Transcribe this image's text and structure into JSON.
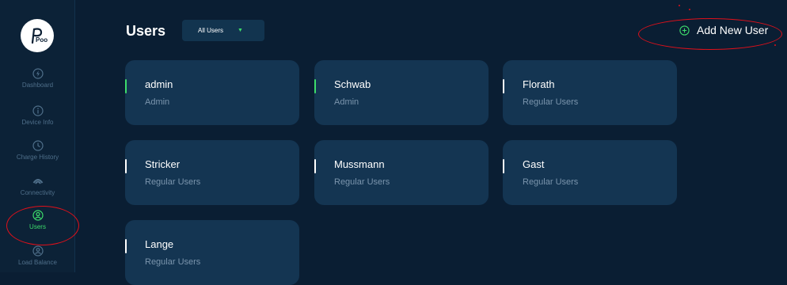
{
  "sidebar": {
    "logo_text": "Poo",
    "items": [
      {
        "label": "Dashboard",
        "icon": "bolt-icon",
        "active": false
      },
      {
        "label": "Device Info",
        "icon": "info-icon",
        "active": false
      },
      {
        "label": "Charge History",
        "icon": "clock-icon",
        "active": false
      },
      {
        "label": "Connectivity",
        "icon": "wifi-icon",
        "active": false
      },
      {
        "label": "Users",
        "icon": "user-icon",
        "active": true
      },
      {
        "label": "Load Balance",
        "icon": "balance-icon",
        "active": false
      }
    ]
  },
  "header": {
    "title": "Users",
    "filter_label": "All Users",
    "add_button_label": "Add New User"
  },
  "users": [
    {
      "name": "admin",
      "role": "Admin"
    },
    {
      "name": "Schwab",
      "role": "Admin"
    },
    {
      "name": "Florath",
      "role": "Regular Users"
    },
    {
      "name": "Stricker",
      "role": "Regular Users"
    },
    {
      "name": "Mussmann",
      "role": "Regular Users"
    },
    {
      "name": "Gast",
      "role": "Regular Users"
    },
    {
      "name": "Lange",
      "role": "Regular Users"
    }
  ],
  "colors": {
    "background": "#0a1e33",
    "card": "#143552",
    "accent": "#3ddc6b",
    "annotation": "#e0101a"
  }
}
